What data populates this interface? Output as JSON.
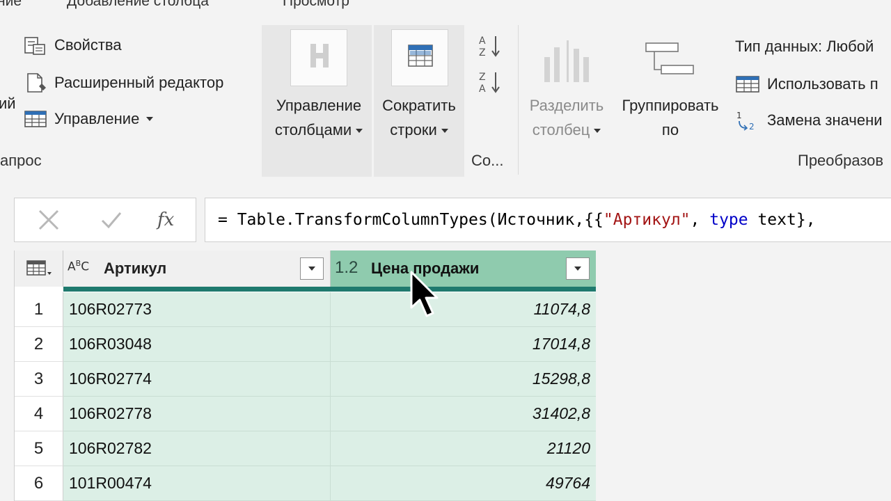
{
  "tabs": [
    "ние",
    "Добавление столбца",
    "Просмотр"
  ],
  "ribbon": {
    "query_group": {
      "properties": "Свойства",
      "advanced_editor": "Расширенный редактор",
      "manage": "Управление",
      "left_fragment": "ий",
      "label": "апрос"
    },
    "manage_columns": {
      "line1": "Управление",
      "line2": "столбцами"
    },
    "reduce_rows": {
      "line1": "Сократить",
      "line2": "строки"
    },
    "sort_label": "Со...",
    "split_column": {
      "line1": "Разделить",
      "line2": "столбец"
    },
    "group_by": {
      "line1": "Группировать",
      "line2": "по"
    },
    "transform": {
      "data_type": "Тип данных: Любой",
      "use_first_row": "Использовать п",
      "replace_values": "Замена значени",
      "label": "Преобразов"
    }
  },
  "formula_bar": {
    "prefix": "= Table.TransformColumnTypes(Источник,{{",
    "string": "\"Артикул\"",
    "separator": ", ",
    "keyword": "type",
    "suffix": " text},"
  },
  "grid": {
    "columns": [
      {
        "type_icon": "ABC",
        "name": "Артикул"
      },
      {
        "type_icon": "1.2",
        "name": "Цена продажи"
      }
    ],
    "rows": [
      {
        "num": "1",
        "article": "106R02773",
        "price": "11074,8"
      },
      {
        "num": "2",
        "article": "106R03048",
        "price": "17014,8"
      },
      {
        "num": "3",
        "article": "106R02774",
        "price": "15298,8"
      },
      {
        "num": "4",
        "article": "106R02778",
        "price": "31402,8"
      },
      {
        "num": "5",
        "article": "106R02782",
        "price": "21120"
      },
      {
        "num": "6",
        "article": "101R00474",
        "price": "49764"
      }
    ]
  },
  "colors": {
    "accent_teal": "#1f7a6e",
    "cell_selected": "#dcefe6",
    "header_selected": "#8fcbae"
  }
}
